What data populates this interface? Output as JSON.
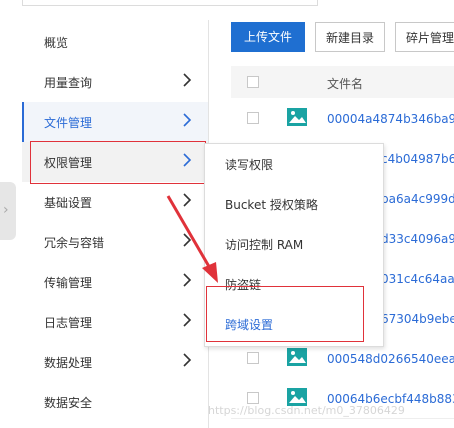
{
  "colors": {
    "accent": "#2b6bd6",
    "primary_button": "#1f6fd1",
    "highlight_box": "#e0323a",
    "file_icon": "#1aa3a3"
  },
  "sidebar": {
    "items": [
      {
        "label": "概览",
        "has_chevron": false
      },
      {
        "label": "用量查询",
        "has_chevron": true
      },
      {
        "label": "文件管理",
        "has_chevron": true,
        "state": "active"
      },
      {
        "label": "权限管理",
        "has_chevron": true,
        "state": "hover"
      },
      {
        "label": "基础设置",
        "has_chevron": true
      },
      {
        "label": "冗余与容错",
        "has_chevron": true
      },
      {
        "label": "传输管理",
        "has_chevron": true
      },
      {
        "label": "日志管理",
        "has_chevron": true
      },
      {
        "label": "数据处理",
        "has_chevron": true
      },
      {
        "label": "数据安全",
        "has_chevron": false
      }
    ]
  },
  "toolbar": {
    "upload_label": "上传文件",
    "new_dir_label": "新建目录",
    "fragment_label": "碎片管理"
  },
  "table": {
    "header_name": "文件名",
    "rows": [
      {
        "name": "00004a4874b346ba9b"
      },
      {
        "name": "c4b04987b6"
      },
      {
        "name": "ba6a4c999d"
      },
      {
        "name": "d33c4096a9"
      },
      {
        "name": "031c4c64aa"
      },
      {
        "name": "67304b9ebe"
      },
      {
        "name": "000548d0266540eeac"
      },
      {
        "name": "00064b6ecbf448b883c"
      }
    ]
  },
  "dropdown": {
    "items": [
      {
        "label": "读写权限"
      },
      {
        "label": "Bucket 授权策略"
      },
      {
        "label": "访问控制 RAM"
      },
      {
        "label": "防盗链"
      },
      {
        "label": "跨域设置",
        "state": "active"
      }
    ]
  },
  "watermark": "https://blog.csdn.net/m0_37806429"
}
